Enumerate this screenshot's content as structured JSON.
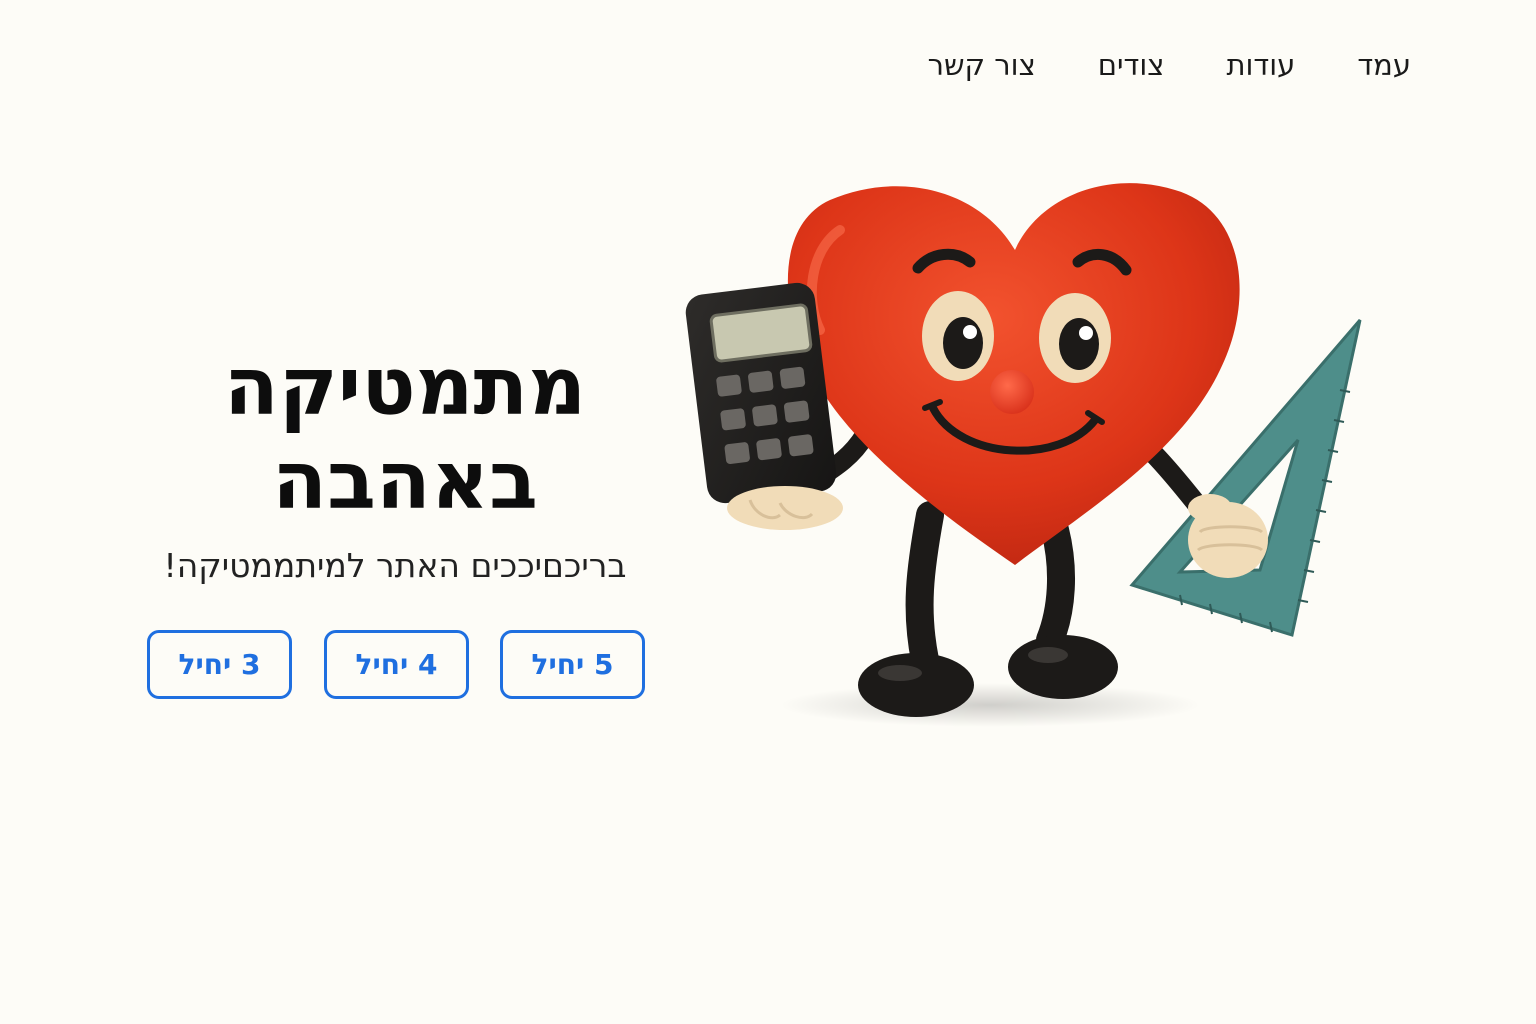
{
  "nav": {
    "items": [
      {
        "label": "עמד"
      },
      {
        "label": "עודות"
      },
      {
        "label": "צודים"
      },
      {
        "label": "צור קשר"
      }
    ]
  },
  "hero": {
    "title_line1": "מתמטיקה",
    "title_line2": "באהבה",
    "subtitle": "בריכםיככים האתר למיתממטיקה!"
  },
  "levels": {
    "five": "5 יחיל",
    "four": "4 יחיל",
    "three": "3 יחיל"
  },
  "illustration": {
    "description_icon": "heart-mascot-illustration",
    "colors": {
      "heart": "#e0391c",
      "limbs": "#1c1a18",
      "glove": "#f1dcb8",
      "ruler": "#4e8e8a",
      "accent": "#1f6fe0"
    }
  }
}
